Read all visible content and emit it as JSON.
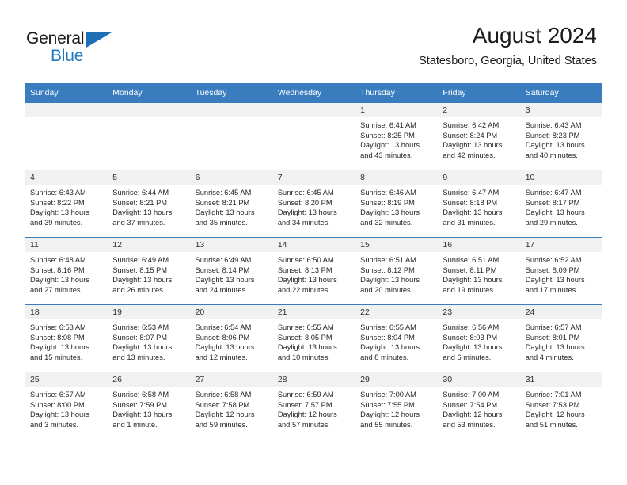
{
  "brand": {
    "name_part1": "General",
    "name_part2": "Blue",
    "accent_color": "#1f7ac4",
    "triangle_color": "#1f6fb5"
  },
  "header": {
    "title": "August 2024",
    "subtitle": "Statesboro, Georgia, United States",
    "header_bg_color": "#3a7dbf"
  },
  "weekday_headers": [
    "Sunday",
    "Monday",
    "Tuesday",
    "Wednesday",
    "Thursday",
    "Friday",
    "Saturday"
  ],
  "weeks": [
    [
      {
        "day": "",
        "sunrise": "",
        "sunset": "",
        "daylight_line1": "",
        "daylight_line2": ""
      },
      {
        "day": "",
        "sunrise": "",
        "sunset": "",
        "daylight_line1": "",
        "daylight_line2": ""
      },
      {
        "day": "",
        "sunrise": "",
        "sunset": "",
        "daylight_line1": "",
        "daylight_line2": ""
      },
      {
        "day": "",
        "sunrise": "",
        "sunset": "",
        "daylight_line1": "",
        "daylight_line2": ""
      },
      {
        "day": "1",
        "sunrise": "Sunrise: 6:41 AM",
        "sunset": "Sunset: 8:25 PM",
        "daylight_line1": "Daylight: 13 hours",
        "daylight_line2": "and 43 minutes."
      },
      {
        "day": "2",
        "sunrise": "Sunrise: 6:42 AM",
        "sunset": "Sunset: 8:24 PM",
        "daylight_line1": "Daylight: 13 hours",
        "daylight_line2": "and 42 minutes."
      },
      {
        "day": "3",
        "sunrise": "Sunrise: 6:43 AM",
        "sunset": "Sunset: 8:23 PM",
        "daylight_line1": "Daylight: 13 hours",
        "daylight_line2": "and 40 minutes."
      }
    ],
    [
      {
        "day": "4",
        "sunrise": "Sunrise: 6:43 AM",
        "sunset": "Sunset: 8:22 PM",
        "daylight_line1": "Daylight: 13 hours",
        "daylight_line2": "and 39 minutes."
      },
      {
        "day": "5",
        "sunrise": "Sunrise: 6:44 AM",
        "sunset": "Sunset: 8:21 PM",
        "daylight_line1": "Daylight: 13 hours",
        "daylight_line2": "and 37 minutes."
      },
      {
        "day": "6",
        "sunrise": "Sunrise: 6:45 AM",
        "sunset": "Sunset: 8:21 PM",
        "daylight_line1": "Daylight: 13 hours",
        "daylight_line2": "and 35 minutes."
      },
      {
        "day": "7",
        "sunrise": "Sunrise: 6:45 AM",
        "sunset": "Sunset: 8:20 PM",
        "daylight_line1": "Daylight: 13 hours",
        "daylight_line2": "and 34 minutes."
      },
      {
        "day": "8",
        "sunrise": "Sunrise: 6:46 AM",
        "sunset": "Sunset: 8:19 PM",
        "daylight_line1": "Daylight: 13 hours",
        "daylight_line2": "and 32 minutes."
      },
      {
        "day": "9",
        "sunrise": "Sunrise: 6:47 AM",
        "sunset": "Sunset: 8:18 PM",
        "daylight_line1": "Daylight: 13 hours",
        "daylight_line2": "and 31 minutes."
      },
      {
        "day": "10",
        "sunrise": "Sunrise: 6:47 AM",
        "sunset": "Sunset: 8:17 PM",
        "daylight_line1": "Daylight: 13 hours",
        "daylight_line2": "and 29 minutes."
      }
    ],
    [
      {
        "day": "11",
        "sunrise": "Sunrise: 6:48 AM",
        "sunset": "Sunset: 8:16 PM",
        "daylight_line1": "Daylight: 13 hours",
        "daylight_line2": "and 27 minutes."
      },
      {
        "day": "12",
        "sunrise": "Sunrise: 6:49 AM",
        "sunset": "Sunset: 8:15 PM",
        "daylight_line1": "Daylight: 13 hours",
        "daylight_line2": "and 26 minutes."
      },
      {
        "day": "13",
        "sunrise": "Sunrise: 6:49 AM",
        "sunset": "Sunset: 8:14 PM",
        "daylight_line1": "Daylight: 13 hours",
        "daylight_line2": "and 24 minutes."
      },
      {
        "day": "14",
        "sunrise": "Sunrise: 6:50 AM",
        "sunset": "Sunset: 8:13 PM",
        "daylight_line1": "Daylight: 13 hours",
        "daylight_line2": "and 22 minutes."
      },
      {
        "day": "15",
        "sunrise": "Sunrise: 6:51 AM",
        "sunset": "Sunset: 8:12 PM",
        "daylight_line1": "Daylight: 13 hours",
        "daylight_line2": "and 20 minutes."
      },
      {
        "day": "16",
        "sunrise": "Sunrise: 6:51 AM",
        "sunset": "Sunset: 8:11 PM",
        "daylight_line1": "Daylight: 13 hours",
        "daylight_line2": "and 19 minutes."
      },
      {
        "day": "17",
        "sunrise": "Sunrise: 6:52 AM",
        "sunset": "Sunset: 8:09 PM",
        "daylight_line1": "Daylight: 13 hours",
        "daylight_line2": "and 17 minutes."
      }
    ],
    [
      {
        "day": "18",
        "sunrise": "Sunrise: 6:53 AM",
        "sunset": "Sunset: 8:08 PM",
        "daylight_line1": "Daylight: 13 hours",
        "daylight_line2": "and 15 minutes."
      },
      {
        "day": "19",
        "sunrise": "Sunrise: 6:53 AM",
        "sunset": "Sunset: 8:07 PM",
        "daylight_line1": "Daylight: 13 hours",
        "daylight_line2": "and 13 minutes."
      },
      {
        "day": "20",
        "sunrise": "Sunrise: 6:54 AM",
        "sunset": "Sunset: 8:06 PM",
        "daylight_line1": "Daylight: 13 hours",
        "daylight_line2": "and 12 minutes."
      },
      {
        "day": "21",
        "sunrise": "Sunrise: 6:55 AM",
        "sunset": "Sunset: 8:05 PM",
        "daylight_line1": "Daylight: 13 hours",
        "daylight_line2": "and 10 minutes."
      },
      {
        "day": "22",
        "sunrise": "Sunrise: 6:55 AM",
        "sunset": "Sunset: 8:04 PM",
        "daylight_line1": "Daylight: 13 hours",
        "daylight_line2": "and 8 minutes."
      },
      {
        "day": "23",
        "sunrise": "Sunrise: 6:56 AM",
        "sunset": "Sunset: 8:03 PM",
        "daylight_line1": "Daylight: 13 hours",
        "daylight_line2": "and 6 minutes."
      },
      {
        "day": "24",
        "sunrise": "Sunrise: 6:57 AM",
        "sunset": "Sunset: 8:01 PM",
        "daylight_line1": "Daylight: 13 hours",
        "daylight_line2": "and 4 minutes."
      }
    ],
    [
      {
        "day": "25",
        "sunrise": "Sunrise: 6:57 AM",
        "sunset": "Sunset: 8:00 PM",
        "daylight_line1": "Daylight: 13 hours",
        "daylight_line2": "and 3 minutes."
      },
      {
        "day": "26",
        "sunrise": "Sunrise: 6:58 AM",
        "sunset": "Sunset: 7:59 PM",
        "daylight_line1": "Daylight: 13 hours",
        "daylight_line2": "and 1 minute."
      },
      {
        "day": "27",
        "sunrise": "Sunrise: 6:58 AM",
        "sunset": "Sunset: 7:58 PM",
        "daylight_line1": "Daylight: 12 hours",
        "daylight_line2": "and 59 minutes."
      },
      {
        "day": "28",
        "sunrise": "Sunrise: 6:59 AM",
        "sunset": "Sunset: 7:57 PM",
        "daylight_line1": "Daylight: 12 hours",
        "daylight_line2": "and 57 minutes."
      },
      {
        "day": "29",
        "sunrise": "Sunrise: 7:00 AM",
        "sunset": "Sunset: 7:55 PM",
        "daylight_line1": "Daylight: 12 hours",
        "daylight_line2": "and 55 minutes."
      },
      {
        "day": "30",
        "sunrise": "Sunrise: 7:00 AM",
        "sunset": "Sunset: 7:54 PM",
        "daylight_line1": "Daylight: 12 hours",
        "daylight_line2": "and 53 minutes."
      },
      {
        "day": "31",
        "sunrise": "Sunrise: 7:01 AM",
        "sunset": "Sunset: 7:53 PM",
        "daylight_line1": "Daylight: 12 hours",
        "daylight_line2": "and 51 minutes."
      }
    ]
  ]
}
